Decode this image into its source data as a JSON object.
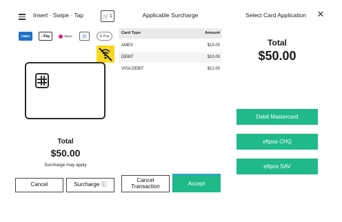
{
  "panel1": {
    "title": "Insert · Swipe · Tap",
    "cart_count": "1",
    "card_logos": {
      "amex": "AMEX",
      "apple_pay": "Pay",
      "eftpos": "eftpos",
      "contactless": ")))",
      "google_pay": "G Pay"
    },
    "total_label": "Total",
    "total_amount": "$50.00",
    "surcharge_note": "Surcharge may apply",
    "cancel_label": "Cancel",
    "surcharge_label": "Surcharge ⓘ"
  },
  "panel2": {
    "title": "Applicable Surcharge",
    "columns": [
      "Card Type",
      "Amount"
    ],
    "rows": [
      {
        "type": "AMEX",
        "amount": "$15.00"
      },
      {
        "type": "DEBIT",
        "amount": "$10.00"
      },
      {
        "type": "VISA DEBIT",
        "amount": "$12.00"
      }
    ],
    "cancel_label": "Cancel Transaction",
    "accept_label": "Accept"
  },
  "panel3": {
    "title": "Select Card Application",
    "total_label": "Total",
    "total_amount": "$50.00",
    "applications": [
      "Debit Mastercard",
      "eftpos CHQ",
      "eftpos SAV"
    ]
  },
  "colors": {
    "accent_green": "#1fb98a",
    "warning_yellow": "#f8d81c",
    "accent_blue": "#2da0d0"
  }
}
